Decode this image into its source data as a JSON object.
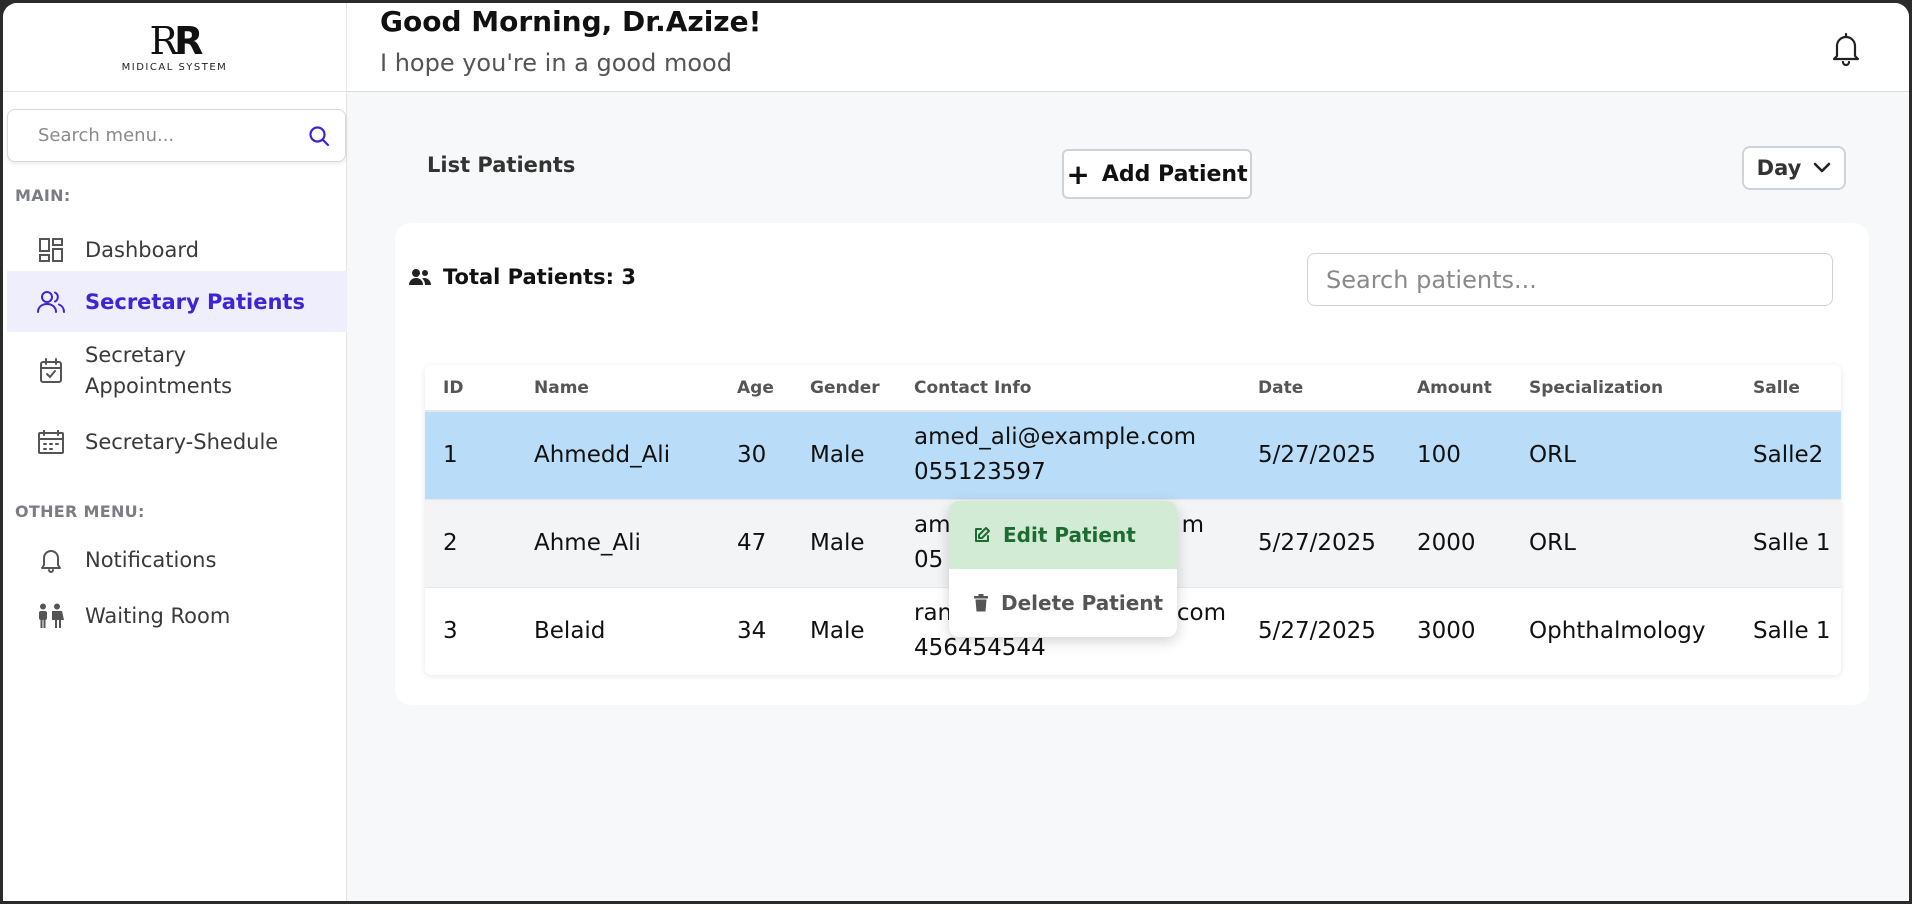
{
  "brand": {
    "mark_a": "R",
    "mark_b": "R",
    "subtitle": "MIDICAL SYSTEM"
  },
  "sidebar": {
    "search_placeholder": "Search menu...",
    "main_label": "MAIN:",
    "other_label": "OTHER MENU:",
    "main_items": [
      {
        "label": "Dashboard",
        "icon": "dashboard-grid-icon"
      },
      {
        "label": "Secretary Patients",
        "icon": "users-icon",
        "active": true
      },
      {
        "label": "Secretary Appointments",
        "icon": "calendar-check-icon"
      },
      {
        "label": "Secretary-Shedule",
        "icon": "calendar-icon"
      }
    ],
    "other_items": [
      {
        "label": "Notifications",
        "icon": "bell-icon"
      },
      {
        "label": "Waiting Room",
        "icon": "people-icon"
      }
    ]
  },
  "header": {
    "greeting": "Good Morning, Dr.Azize!",
    "subtitle": "I hope you're in a good mood",
    "bell_icon": "bell-icon"
  },
  "main": {
    "list_title": "List Patients",
    "add_button": "Add Patient",
    "period_select": "Day",
    "total_label": "Total Patients: 3",
    "search_placeholder": "Search patients..."
  },
  "table": {
    "columns": [
      "ID",
      "Name",
      "Age",
      "Gender",
      "Contact Info",
      "Date",
      "Amount",
      "Specialization",
      "Salle"
    ],
    "rows": [
      {
        "id": "1",
        "name": "Ahmedd_Ali",
        "age": "30",
        "gender": "Male",
        "email": "amed_ali@example.com",
        "phone": "055123597",
        "date": "5/27/2025",
        "amount": "100",
        "specialization": "ORL",
        "salle": "Salle2"
      },
      {
        "id": "2",
        "name": "Ahme_Ali",
        "age": "47",
        "gender": "Male",
        "email": "am",
        "email_tail": "m",
        "phone": "05",
        "date": "5/27/2025",
        "amount": "2000",
        "specialization": "ORL",
        "salle": "Salle 1"
      },
      {
        "id": "3",
        "name": "Belaid",
        "age": "34",
        "gender": "Male",
        "email": "ran",
        "email_tail": ".com",
        "phone": "456454544",
        "date": "5/27/2025",
        "amount": "3000",
        "specialization": "Ophthalmology",
        "salle": "Salle 1"
      }
    ]
  },
  "context_menu": {
    "edit": "Edit Patient",
    "delete": "Delete Patient"
  },
  "colors": {
    "accent": "#3d24d6",
    "selected_row": "#b9dcf8",
    "edit_bg": "#d1ebd5",
    "edit_text": "#1e6b31"
  }
}
